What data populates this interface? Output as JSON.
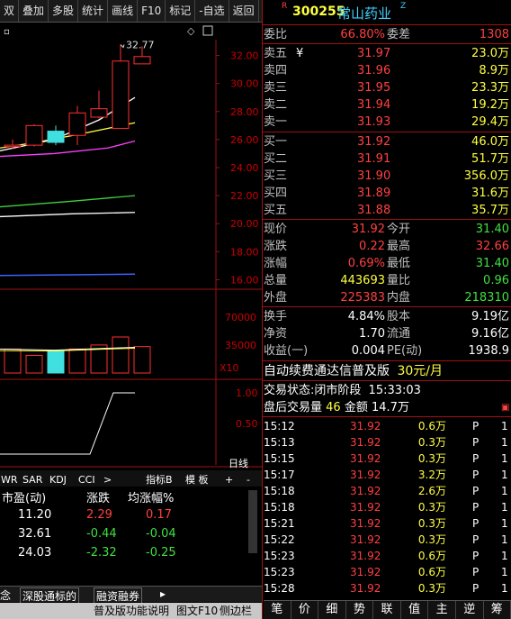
{
  "toolbar": [
    "双",
    "叠加",
    "多股",
    "统计",
    "画线",
    "F10",
    "标记",
    "-自选",
    "返回"
  ],
  "stock": {
    "market_mark": "R",
    "code": "300255",
    "name": "常山药业",
    "mark_z": "Z"
  },
  "weibi": {
    "l1": "委比",
    "v1": "66.80%",
    "l2": "委差",
    "v2": "1308"
  },
  "sell": [
    {
      "label": "卖五",
      "price": "31.97",
      "vol": "23.0万"
    },
    {
      "label": "卖四",
      "price": "31.96",
      "vol": "8.9万"
    },
    {
      "label": "卖三",
      "price": "31.95",
      "vol": "23.3万"
    },
    {
      "label": "卖二",
      "price": "31.94",
      "vol": "19.2万"
    },
    {
      "label": "卖一",
      "price": "31.93",
      "vol": "29.4万"
    }
  ],
  "sell5_mark": "¥",
  "buy": [
    {
      "label": "买一",
      "price": "31.92",
      "vol": "46.0万"
    },
    {
      "label": "买二",
      "price": "31.91",
      "vol": "51.7万"
    },
    {
      "label": "买三",
      "price": "31.90",
      "vol": "356.0万"
    },
    {
      "label": "买四",
      "price": "31.89",
      "vol": "31.6万"
    },
    {
      "label": "买五",
      "price": "31.88",
      "vol": "35.7万"
    }
  ],
  "quote": [
    {
      "l1": "现价",
      "v1": "31.92",
      "c1": "red",
      "l2": "今开",
      "v2": "31.40",
      "c2": "grn"
    },
    {
      "l1": "涨跌",
      "v1": "0.22",
      "c1": "red",
      "l2": "最高",
      "v2": "32.66",
      "c2": "red"
    },
    {
      "l1": "涨幅",
      "v1": "0.69%",
      "c1": "red",
      "l2": "最低",
      "v2": "31.40",
      "c2": "grn"
    },
    {
      "l1": "总量",
      "v1": "443693",
      "c1": "yel",
      "l2": "量比",
      "v2": "0.96",
      "c2": "grn"
    },
    {
      "l1": "外盘",
      "v1": "225383",
      "c1": "red",
      "l2": "内盘",
      "v2": "218310",
      "c2": "grn"
    }
  ],
  "quote2": [
    {
      "l1": "换手",
      "v1": "4.84%",
      "l2": "股本",
      "v2": "9.19亿"
    },
    {
      "l1": "净资",
      "v1": "1.70",
      "l2": "流通",
      "v2": "9.16亿"
    },
    {
      "l1": "收益(一)",
      "v1": "0.004",
      "l2": "PE(动)",
      "v2": "1938.9"
    }
  ],
  "promo": {
    "text": "自动续费通达信普及版",
    "price": "30元/月"
  },
  "status": {
    "label": "交易状态:",
    "phase": "闭市阶段",
    "time": "15:33:03"
  },
  "after": {
    "label": "盘后交易量",
    "vol": "46",
    "amount": "金额",
    "amt": "14.7万"
  },
  "ticks": [
    {
      "t": "15:12",
      "p": "31.92",
      "v": "0.6万",
      "f": "P",
      "n": "1"
    },
    {
      "t": "15:13",
      "p": "31.92",
      "v": "0.3万",
      "f": "P",
      "n": "1"
    },
    {
      "t": "15:15",
      "p": "31.92",
      "v": "0.3万",
      "f": "P",
      "n": "1"
    },
    {
      "t": "15:17",
      "p": "31.92",
      "v": "3.2万",
      "f": "P",
      "n": "1"
    },
    {
      "t": "15:18",
      "p": "31.92",
      "v": "2.6万",
      "f": "P",
      "n": "1"
    },
    {
      "t": "15:18",
      "p": "31.92",
      "v": "0.3万",
      "f": "P",
      "n": "1"
    },
    {
      "t": "15:21",
      "p": "31.92",
      "v": "0.3万",
      "f": "P",
      "n": "1"
    },
    {
      "t": "15:22",
      "p": "31.92",
      "v": "0.3万",
      "f": "P",
      "n": "1"
    },
    {
      "t": "15:23",
      "p": "31.92",
      "v": "0.6万",
      "f": "P",
      "n": "1"
    },
    {
      "t": "15:23",
      "p": "31.92",
      "v": "0.6万",
      "f": "P",
      "n": "1"
    },
    {
      "t": "15:28",
      "p": "31.92",
      "v": "0.3万",
      "f": "P",
      "n": "1"
    }
  ],
  "bottom_tabs": [
    "笔",
    "价",
    "细",
    "势",
    "联",
    "值",
    "主",
    "逆",
    "筹"
  ],
  "kline": {
    "max_label": "32.77",
    "y_ticks": [
      "32.00",
      "30.00",
      "28.00",
      "26.00",
      "24.00",
      "22.00",
      "20.00",
      "18.00",
      "16.00"
    ],
    "vol_ticks": [
      "70000",
      "35000"
    ],
    "vol_unit": "X10",
    "ind_ticks": [
      "1.00",
      "0.50"
    ],
    "period": "日线"
  },
  "ind_tabs": [
    "WR",
    "SAR",
    "KDJ",
    "CCI",
    ">"
  ],
  "ind_b": "指标B",
  "template": "模 板",
  "plus": "+",
  "minus": "-",
  "sector": {
    "headers": [
      "市盈(动)",
      "涨跌",
      "均涨幅%"
    ],
    "rows": [
      [
        "11.20",
        "2.29",
        "0.17"
      ],
      [
        "32.61",
        "-0.44",
        "-0.04"
      ],
      [
        "24.03",
        "-2.32",
        "-0.25"
      ]
    ]
  },
  "left_tabs": [
    "念",
    "深股通标的",
    "融资融券"
  ],
  "status_bar": [
    "普及版功能说明",
    "图文F10",
    "侧边栏"
  ],
  "chart_data": {
    "type": "candlestick",
    "ylim": [
      15,
      33
    ],
    "y_ticks": [
      16,
      18,
      20,
      22,
      24,
      26,
      28,
      30,
      32
    ],
    "max_annotation": 32.77,
    "candles": [
      {
        "open": 25.5,
        "close": 25.6,
        "high": 26.0,
        "low": 25.3
      },
      {
        "open": 25.6,
        "close": 27.0,
        "high": 27.1,
        "low": 25.5
      },
      {
        "open": 26.6,
        "close": 25.8,
        "high": 27.0,
        "low": 25.6
      },
      {
        "open": 26.3,
        "close": 27.9,
        "high": 28.4,
        "low": 25.6
      },
      {
        "open": 27.6,
        "close": 28.2,
        "high": 29.5,
        "low": 27.5
      },
      {
        "open": 26.8,
        "close": 31.6,
        "high": 32.77,
        "low": 26.8
      },
      {
        "open": 31.4,
        "close": 31.92,
        "high": 32.66,
        "low": 31.4
      }
    ],
    "volume_ylim": [
      0,
      90000
    ],
    "volume": [
      30000,
      22000,
      28000,
      30000,
      35000,
      45000,
      33000
    ]
  }
}
